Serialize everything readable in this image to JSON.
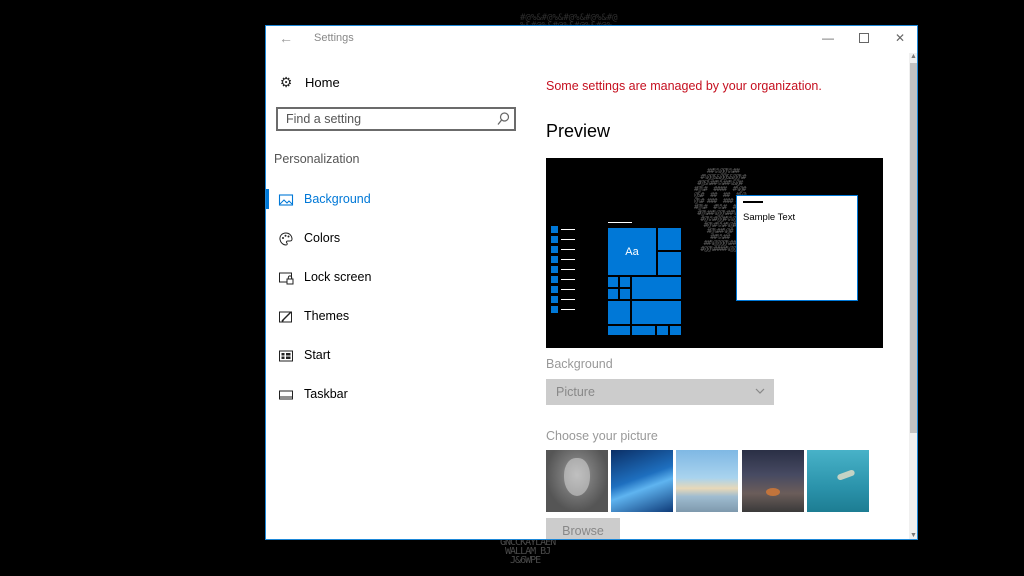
{
  "window": {
    "title": "Settings",
    "controls": {
      "minimize": "—",
      "close": "✕"
    }
  },
  "sidebar": {
    "home_label": "Home",
    "search_placeholder": "Find a setting",
    "section_label": "Personalization",
    "items": [
      {
        "label": "Background",
        "icon": "picture-icon",
        "active": true
      },
      {
        "label": "Colors",
        "icon": "palette-icon",
        "active": false
      },
      {
        "label": "Lock screen",
        "icon": "lock-screen-icon",
        "active": false
      },
      {
        "label": "Themes",
        "icon": "themes-icon",
        "active": false
      },
      {
        "label": "Start",
        "icon": "start-icon",
        "active": false
      },
      {
        "label": "Taskbar",
        "icon": "taskbar-icon",
        "active": false
      }
    ]
  },
  "main": {
    "org_message": "Some settings are managed by your organization.",
    "preview_heading": "Preview",
    "preview": {
      "sample_text": "Sample Text",
      "tile_label": "Aa"
    },
    "background_label": "Background",
    "background_value": "Picture",
    "choose_label": "Choose your picture",
    "browse_label": "Browse"
  },
  "colors": {
    "accent": "#0078d7",
    "warning": "#c50f1f"
  }
}
